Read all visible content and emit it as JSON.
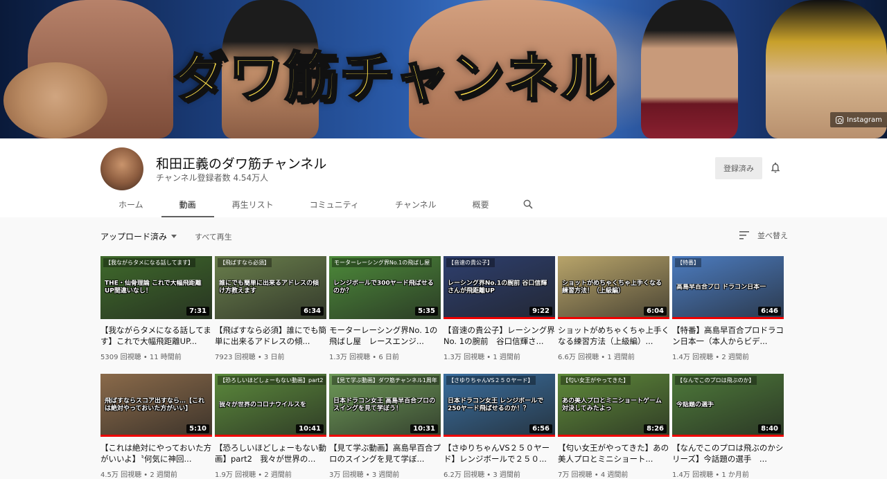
{
  "banner": {
    "title": "ダワ筋チャンネル",
    "instagram_label": "Instagram"
  },
  "channel": {
    "name": "和田正義のダワ筋チャンネル",
    "subscribers": "チャンネル登録者数 4.54万人",
    "subscribed_label": "登録済み"
  },
  "tabs": [
    "ホーム",
    "動画",
    "再生リスト",
    "コミュニティ",
    "チャンネル",
    "概要"
  ],
  "filters": {
    "uploads_label": "アップロード済み",
    "play_all_label": "すべて再生",
    "sort_label": "並べ替え"
  },
  "colors": {
    "accent": "#ff0000",
    "progress": "#e00000",
    "text_secondary": "#606060"
  },
  "videos": [
    {
      "title": "【我ながらタメになる話してます】これで大幅飛距離UP...",
      "views": "5309 回視聴",
      "age": "11 時間前",
      "duration": "7:31",
      "tag": "【我ながらタメになる話してます】",
      "caption": "THE・仙骨理論 これで大幅飛距離UP間違いなし！",
      "bg": "#3f6a2b",
      "watched": 0
    },
    {
      "title": "【飛ばすなら必須】誰にでも簡単に出来るアドレスの傾...",
      "views": "7923 回視聴",
      "age": "3 日前",
      "duration": "6:34",
      "tag": "【飛ばすなら必須】",
      "caption": "誰にでも簡単に出来るアドレスの傾け方教えます",
      "bg": "#6a7f4c",
      "watched": 0
    },
    {
      "title": "モーターレーシング界No. 1の飛ばし屋　レースエンジ...",
      "views": "1.3万 回視聴",
      "age": "6 日前",
      "duration": "5:35",
      "tag": "モーターレーシング界No.1の飛ばし屋",
      "caption": "レンジボールで300ヤード飛ばせるのか？",
      "bg": "#4d8a3a",
      "watched": 0
    },
    {
      "title": "【音速の貴公子】レーシング界No. 1の腕前　谷口信輝さ...",
      "views": "1.3万 回視聴",
      "age": "1 週間前",
      "duration": "9:22",
      "tag": "【音速の貴公子】",
      "caption": "レーシング界No.1の腕前 谷口信輝さんが飛距離UP",
      "bg": "#2e3f6e",
      "watched": 1
    },
    {
      "title": "ショットがめちゃくちゃ上手くなる練習方法（上級編）...",
      "views": "6.6万 回視聴",
      "age": "1 週間前",
      "duration": "6:04",
      "tag": "",
      "caption": "ショットがめちゃくちゃ上手くなる練習方法！（上級編）",
      "bg": "#b8a46a",
      "watched": 1
    },
    {
      "title": "【特番】高島早百合プロドラコン日本一（本人からビデ...",
      "views": "1.4万 回視聴",
      "age": "2 週間前",
      "duration": "6:46",
      "tag": "【特番】",
      "caption": "高島早百合プロ ドラコン日本一",
      "bg": "#4c7cc0",
      "watched": 1
    },
    {
      "title": "【これは絶対にやっておいた方がいいよ】〝何気に神回...",
      "views": "4.5万 回視聴",
      "age": "2 週間前",
      "duration": "5:10",
      "tag": "",
      "caption": "飛ばすならスコア出すなら…【これは絶対やっておいた方がいい】",
      "bg": "#8a6a4a",
      "watched": 1
    },
    {
      "title": "【恐ろしいほどしょーもない動画】part2　我々が世界の...",
      "views": "1.9万 回視聴",
      "age": "2 週間前",
      "duration": "10:41",
      "tag": "【恐ろしいほどしょーもない動画】part2",
      "caption": "我々が世界のコロナウイルスを",
      "bg": "#5c8a3c",
      "watched": 1
    },
    {
      "title": "【見て学ぶ動画】高島早百合プロのスイングを見て学ぼ...",
      "views": "3万 回視聴",
      "age": "3 週間前",
      "duration": "10:31",
      "tag": "【見て学ぶ動画】ダワ筋チャンネル1周年",
      "caption": "日本ドラコン女王 高島早百合プロのスイングを見て学ぼう！",
      "bg": "#6e9a58",
      "watched": 1
    },
    {
      "title": "【さゆりちゃんVS２５０ヤード】レンジボールで２５０...",
      "views": "6.2万 回視聴",
      "age": "3 週間前",
      "duration": "6:56",
      "tag": "【さゆりちゃんVS２５０ヤード】",
      "caption": "日本ドラコン女王 レンジボールで250ヤード飛ばせるのか！？",
      "bg": "#3a6e9e",
      "watched": 1
    },
    {
      "title": "【匂い女王がやってきた】あの美人プロとミニショート...",
      "views": "7万 回視聴",
      "age": "4 週間前",
      "duration": "8:26",
      "tag": "【匂い女王がやってきた】",
      "caption": "あの美人プロとミニショートゲーム対決してみたよっ",
      "bg": "#5f8a3a",
      "watched": 1
    },
    {
      "title": "【なんでこのプロは飛ぶのかシリーズ】今話題の選手　...",
      "views": "1.4万 回視聴",
      "age": "1 か月前",
      "duration": "8:40",
      "tag": "【なんでこのプロは飛ぶのか】",
      "caption": "今話題の選手",
      "bg": "#4e7a3a",
      "watched": 1
    }
  ]
}
